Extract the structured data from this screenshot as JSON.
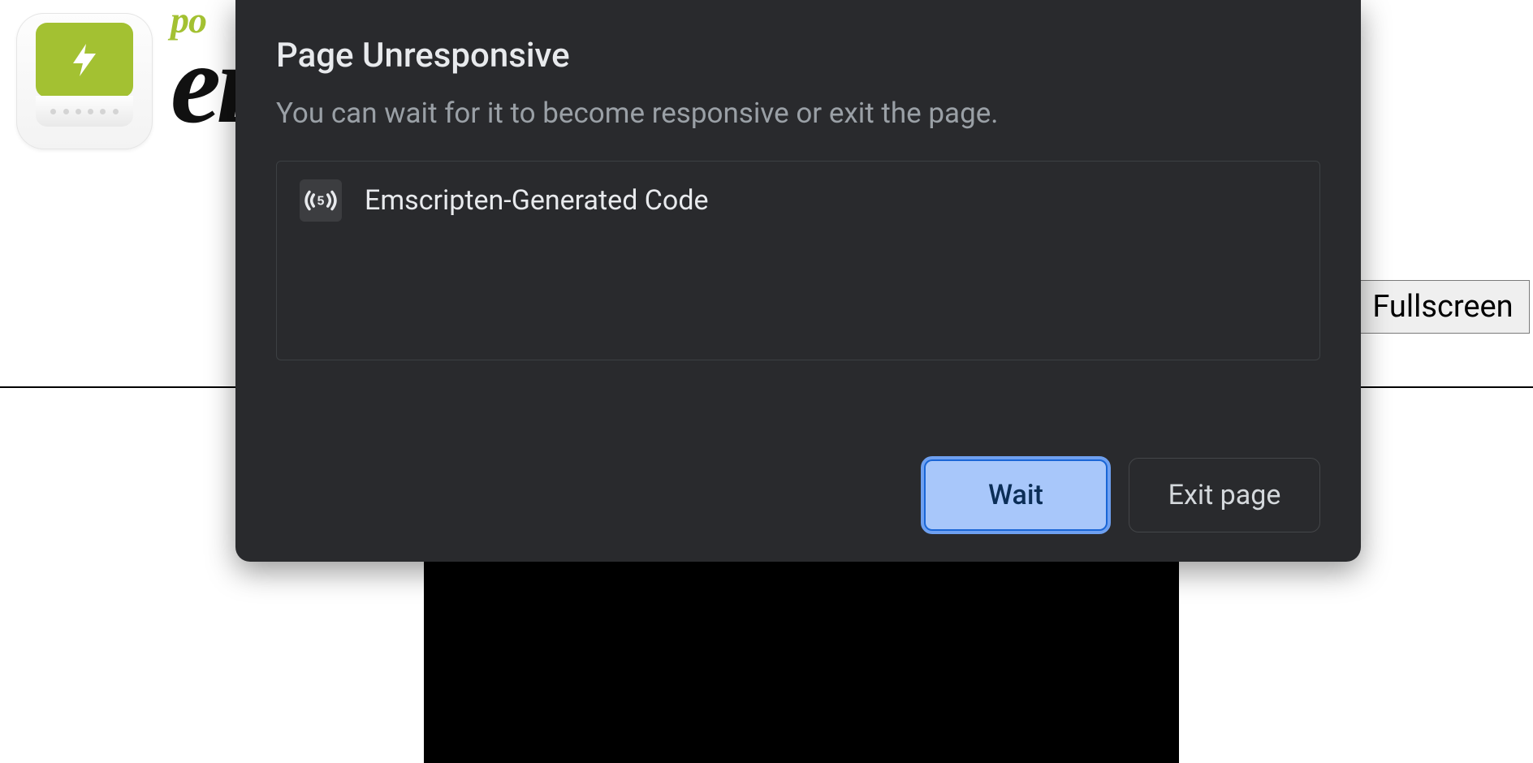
{
  "background": {
    "logo_prefix": "po",
    "logo_main": "eı",
    "fullscreen_label": "Fullscreen",
    "app_icon_name": "lightning-app-icon"
  },
  "dialog": {
    "title": "Page Unresponsive",
    "subtitle": "You can wait for it to become responsive or exit the page.",
    "items": [
      {
        "favicon_label": "((5))",
        "label": "Emscripten-Generated Code"
      }
    ],
    "wait_label": "Wait",
    "exit_label": "Exit page"
  }
}
